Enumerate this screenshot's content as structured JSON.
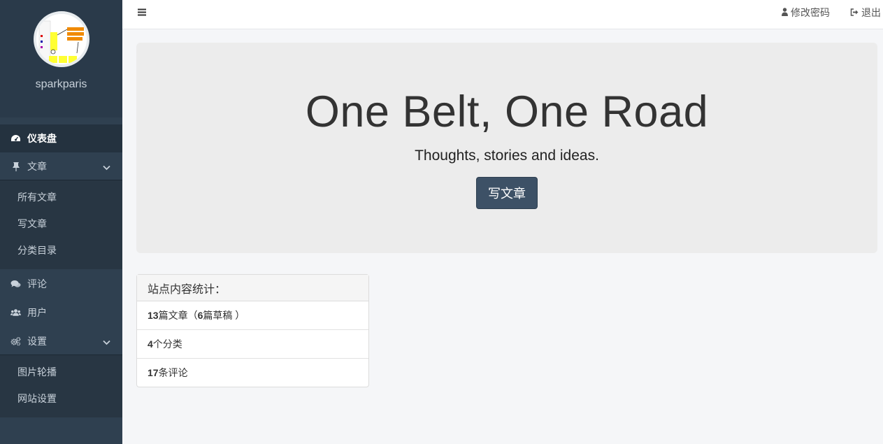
{
  "sidebar": {
    "username": "sparkparis",
    "items": {
      "dashboard": "仪表盘",
      "articles": "文章",
      "comments": "评论",
      "users": "用户",
      "settings": "设置"
    },
    "article_sub": [
      "所有文章",
      "写文章",
      "分类目录"
    ],
    "settings_sub": [
      "图片轮播",
      "网站设置"
    ]
  },
  "topbar": {
    "change_password": "修改密码",
    "logout": "退出"
  },
  "jumbotron": {
    "title": "One Belt, One Road",
    "subtitle": "Thoughts, stories and ideas.",
    "button": "写文章"
  },
  "stats": {
    "heading": "站点内容统计：",
    "posts_count": "13",
    "posts_label": "篇文章（",
    "drafts_count": "6",
    "drafts_label": "篇草稿 ）",
    "categories_count": "4",
    "categories_label": "个分类",
    "comments_count": "17",
    "comments_label": "条评论"
  },
  "icons": {
    "dashboard": "dashboard-icon",
    "articles": "thumbtack-icon",
    "comments": "comments-icon",
    "users": "users-icon",
    "settings": "cogs-icon",
    "user": "user-icon",
    "logout": "sign-out-icon",
    "menu": "bars-icon"
  },
  "colors": {
    "sidebar": "#2f4050",
    "button": "#3d5166",
    "jumbotron": "#ececec"
  }
}
